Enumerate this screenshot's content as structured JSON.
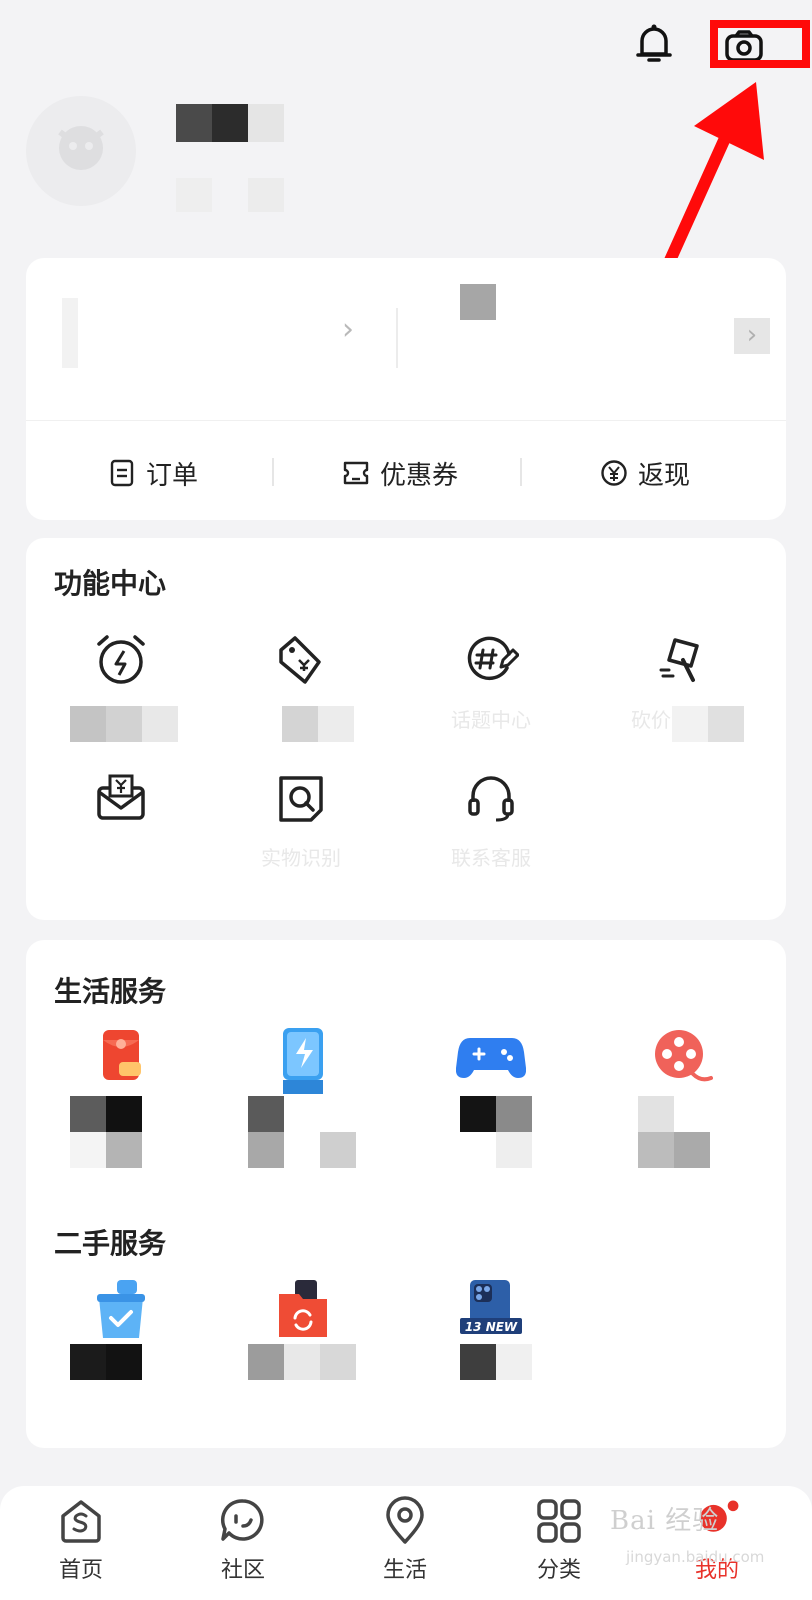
{
  "header": {
    "bell_icon": "bell-icon",
    "camera_icon": "camera-icon"
  },
  "quick_actions": [
    {
      "label": "订单",
      "icon": "order-list-icon"
    },
    {
      "label": "优惠券",
      "icon": "coupon-icon"
    },
    {
      "label": "返现",
      "icon": "yen-circle-icon"
    }
  ],
  "function_center": {
    "title": "功能中心",
    "items": [
      {
        "icon": "alarm-flash-icon",
        "label": ""
      },
      {
        "icon": "price-tag-icon",
        "label": ""
      },
      {
        "icon": "topic-edit-icon",
        "label": "话题中心"
      },
      {
        "icon": "bargain-hammer-icon",
        "label": "砍价免费拿"
      },
      {
        "icon": "wallet-envelope-icon",
        "label": ""
      },
      {
        "icon": "scan-search-icon",
        "label": "实物识别"
      },
      {
        "icon": "headset-icon",
        "label": "联系客服"
      }
    ]
  },
  "life_services": {
    "title": "生活服务",
    "items": [
      {
        "icon": "red-packet-coffee-icon"
      },
      {
        "icon": "blue-card-flash-icon"
      },
      {
        "icon": "gamepad-icon"
      },
      {
        "icon": "film-reel-icon"
      }
    ]
  },
  "second_hand": {
    "title": "二手服务",
    "items": [
      {
        "icon": "checked-box-icon"
      },
      {
        "icon": "recycle-folder-icon"
      },
      {
        "icon": "phone-13-new-icon",
        "badge": "13 NEW"
      }
    ]
  },
  "tabbar": {
    "tabs": [
      {
        "label": "首页",
        "icon": "home-s-icon",
        "active": false
      },
      {
        "label": "社区",
        "icon": "community-bubble-icon",
        "active": false
      },
      {
        "label": "生活",
        "icon": "location-pin-icon",
        "active": false
      },
      {
        "label": "分类",
        "icon": "grid-four-icon",
        "active": false
      },
      {
        "label": "我的",
        "icon": "profile-dot-icon",
        "active": true
      }
    ]
  },
  "watermark": {
    "text": "Bai 经验",
    "sub": "jingyan.baidu.com"
  },
  "colors": {
    "accent": "#e8322a",
    "highlight": "#ff0a0a",
    "background": "#f3f3f5"
  }
}
